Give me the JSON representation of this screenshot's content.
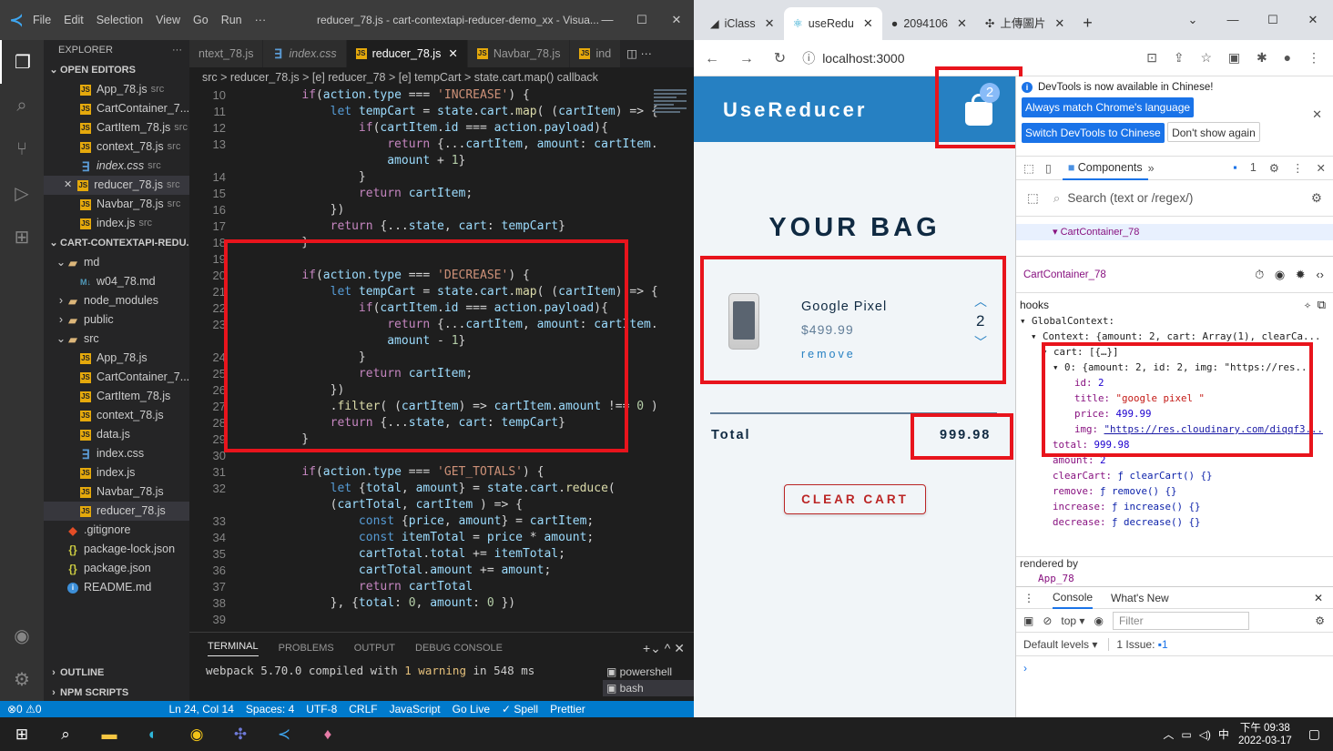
{
  "vscode": {
    "menu": [
      "File",
      "Edit",
      "Selection",
      "View",
      "Go",
      "Run",
      "···"
    ],
    "window_title": "reducer_78.js - cart-contextapi-reducer-demo_xx - Visua...",
    "explorer": {
      "header": "EXPLORER",
      "open_editors_title": "OPEN EDITORS",
      "open_editors": [
        {
          "name": "App_78.js",
          "dir": "src",
          "icon": "js"
        },
        {
          "name": "CartContainer_7...",
          "dir": "",
          "icon": "js"
        },
        {
          "name": "CartItem_78.js",
          "dir": "src",
          "icon": "js"
        },
        {
          "name": "context_78.js",
          "dir": "src",
          "icon": "js"
        },
        {
          "name": "index.css",
          "dir": "src",
          "icon": "css"
        },
        {
          "name": "reducer_78.js",
          "dir": "src",
          "icon": "js",
          "selected": true
        },
        {
          "name": "Navbar_78.js",
          "dir": "src",
          "icon": "js"
        },
        {
          "name": "index.js",
          "dir": "src",
          "icon": "js"
        }
      ],
      "project_title": "CART-CONTEXTAPI-REDU...",
      "tree": [
        {
          "name": "md",
          "indent": 1,
          "icon": "md-folder",
          "chev": "v"
        },
        {
          "name": "w04_78.md",
          "indent": 2,
          "icon": "md"
        },
        {
          "name": "node_modules",
          "indent": 1,
          "icon": "folder",
          "chev": ">"
        },
        {
          "name": "public",
          "indent": 1,
          "icon": "folder",
          "chev": ">"
        },
        {
          "name": "src",
          "indent": 1,
          "icon": "folder",
          "chev": "v"
        },
        {
          "name": "App_78.js",
          "indent": 2,
          "icon": "js"
        },
        {
          "name": "CartContainer_7...",
          "indent": 2,
          "icon": "js"
        },
        {
          "name": "CartItem_78.js",
          "indent": 2,
          "icon": "js"
        },
        {
          "name": "context_78.js",
          "indent": 2,
          "icon": "js"
        },
        {
          "name": "data.js",
          "indent": 2,
          "icon": "js"
        },
        {
          "name": "index.css",
          "indent": 2,
          "icon": "css"
        },
        {
          "name": "index.js",
          "indent": 2,
          "icon": "js"
        },
        {
          "name": "Navbar_78.js",
          "indent": 2,
          "icon": "js"
        },
        {
          "name": "reducer_78.js",
          "indent": 2,
          "icon": "js",
          "selected": true
        },
        {
          "name": ".gitignore",
          "indent": 1,
          "icon": "git"
        },
        {
          "name": "package-lock.json",
          "indent": 1,
          "icon": "json"
        },
        {
          "name": "package.json",
          "indent": 1,
          "icon": "json"
        },
        {
          "name": "README.md",
          "indent": 1,
          "icon": "info"
        }
      ],
      "outline": "OUTLINE",
      "npm_scripts": "NPM SCRIPTS"
    },
    "tabs": [
      {
        "label": "ntext_78.js",
        "icon": "",
        "active": false
      },
      {
        "label": "index.css",
        "icon": "css",
        "active": false
      },
      {
        "label": "reducer_78.js",
        "icon": "js",
        "active": true
      },
      {
        "label": "Navbar_78.js",
        "icon": "js",
        "active": false
      },
      {
        "label": "ind",
        "icon": "js",
        "active": false
      }
    ],
    "breadcrumb": "src > reducer_78.js > [e] reducer_78 > [e] tempCart > state.cart.map() callback",
    "code": [
      {
        "n": "10",
        "t": "    if(action.type === 'INCREASE') {"
      },
      {
        "n": "11",
        "t": "        let tempCart = state.cart.map( (cartItem) => {"
      },
      {
        "n": "12",
        "t": "            if(cartItem.id === action.payload){"
      },
      {
        "n": "13",
        "t": "                return {...cartItem, amount: cartItem."
      },
      {
        "n": "",
        "t": "                amount + 1}"
      },
      {
        "n": "14",
        "t": "            }"
      },
      {
        "n": "15",
        "t": "            return cartItem;"
      },
      {
        "n": "16",
        "t": "        })"
      },
      {
        "n": "17",
        "t": "        return {...state, cart: tempCart}"
      },
      {
        "n": "18",
        "t": "    }"
      },
      {
        "n": "19",
        "t": ""
      },
      {
        "n": "20",
        "t": "    if(action.type === 'DECREASE') {"
      },
      {
        "n": "21",
        "t": "        let tempCart = state.cart.map( (cartItem) => {"
      },
      {
        "n": "22",
        "t": "            if(cartItem.id === action.payload){"
      },
      {
        "n": "23",
        "t": "                return {...cartItem, amount: cartItem."
      },
      {
        "n": "",
        "t": "                amount - 1}"
      },
      {
        "n": "24",
        "t": "            }"
      },
      {
        "n": "25",
        "t": "            return cartItem;"
      },
      {
        "n": "26",
        "t": "        })"
      },
      {
        "n": "27",
        "t": "        .filter( (cartItem) => cartItem.amount !== 0 )"
      },
      {
        "n": "28",
        "t": "        return {...state, cart: tempCart}"
      },
      {
        "n": "29",
        "t": "    }"
      },
      {
        "n": "30",
        "t": ""
      },
      {
        "n": "31",
        "t": "    if(action.type === 'GET_TOTALS') {"
      },
      {
        "n": "32",
        "t": "        let {total, amount} = state.cart.reduce("
      },
      {
        "n": "",
        "t": "        (cartTotal, cartItem ) => {"
      },
      {
        "n": "33",
        "t": "            const {price, amount} = cartItem;"
      },
      {
        "n": "34",
        "t": "            const itemTotal = price * amount;"
      },
      {
        "n": "35",
        "t": "            cartTotal.total += itemTotal;"
      },
      {
        "n": "36",
        "t": "            cartTotal.amount += amount;"
      },
      {
        "n": "37",
        "t": "            return cartTotal"
      },
      {
        "n": "38",
        "t": "        }, {total: 0, amount: 0 })"
      },
      {
        "n": "39",
        "t": ""
      }
    ],
    "panel_tabs": [
      "TERMINAL",
      "PROBLEMS",
      "OUTPUT",
      "DEBUG CONSOLE"
    ],
    "terminal_line_a": "webpack 5.70.0 compiled with ",
    "terminal_warning": "1 warning",
    "terminal_line_b": " in 548 ms",
    "terminals": [
      "powershell",
      "bash"
    ],
    "status": [
      "⊗0 ⚠0",
      "Ln 24, Col 14",
      "Spaces: 4",
      "UTF-8",
      "CRLF",
      "JavaScript",
      "Go Live",
      "✓ Spell",
      "Prettier"
    ]
  },
  "chrome": {
    "tabs": [
      {
        "label": "iClass",
        "active": false
      },
      {
        "label": "useRedu",
        "active": true
      },
      {
        "label": "2094106",
        "active": false
      },
      {
        "label": "上傳圖片",
        "active": false
      }
    ],
    "url": "localhost:3000",
    "app": {
      "brand": "UseReducer",
      "bag_count": "2",
      "bag_title": "YOUR BAG",
      "item_title": "Google Pixel",
      "item_price": "$499.99",
      "item_remove": "remove",
      "item_amount": "2",
      "total_label": "Total",
      "total_value": "999.98",
      "clear_label": "CLEAR CART"
    },
    "devtools": {
      "notice": "DevTools is now available in Chinese!",
      "btn_match": "Always match Chrome's language",
      "btn_switch": "Switch DevTools to Chinese",
      "btn_dont": "Don't show again",
      "panel": "Components",
      "issues_count": "1",
      "search_placeholder": "Search (text or /regex/)",
      "tree_selected": "CartContainer_78",
      "component_name": "CartContainer_78",
      "hooks_label": "hooks",
      "props": [
        {
          "depth": 0,
          "text": "▾ GlobalContext:"
        },
        {
          "depth": 1,
          "text": "▾ Context: {amount: 2, cart: Array(1), clearCa..."
        },
        {
          "depth": 2,
          "text": "▾ cart: [{…}]"
        },
        {
          "depth": 3,
          "text": "▾ 0: {amount: 2, id: 2, img: \"https://res..."
        },
        {
          "depth": 4,
          "key": "id: ",
          "val": "2",
          "type": "num"
        },
        {
          "depth": 4,
          "key": "title: ",
          "val": "\"google pixel \"",
          "type": "str"
        },
        {
          "depth": 4,
          "key": "price: ",
          "val": "499.99",
          "type": "num"
        },
        {
          "depth": 4,
          "key": "img: ",
          "val": "\"https://res.cloudinary.com/diqqf3...",
          "type": "url"
        },
        {
          "depth": 2,
          "key": "total: ",
          "val": "999.98",
          "type": "num"
        },
        {
          "depth": 2,
          "key": "amount: ",
          "val": "2",
          "type": "num"
        },
        {
          "depth": 2,
          "key": "clearCart: ",
          "val": "ƒ clearCart() {}",
          "type": "fn"
        },
        {
          "depth": 2,
          "key": "remove: ",
          "val": "ƒ remove() {}",
          "type": "fn"
        },
        {
          "depth": 2,
          "key": "increase: ",
          "val": "ƒ increase() {}",
          "type": "fn"
        },
        {
          "depth": 2,
          "key": "decrease: ",
          "val": "ƒ decrease() {}",
          "type": "fn"
        }
      ],
      "rendered_by": "rendered by",
      "rendered_app": "App_78",
      "drawer_tabs": [
        "Console",
        "What's New"
      ],
      "context": "top ▾",
      "filter_placeholder": "Filter",
      "levels": "Default levels ▾",
      "issue_label": "1 Issue: ",
      "issue_count": "1"
    }
  },
  "taskbar": {
    "time": "下午 09:38",
    "date": "2022-03-17"
  }
}
